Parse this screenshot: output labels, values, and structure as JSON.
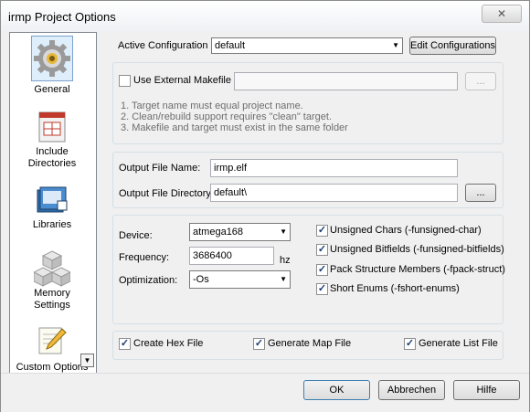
{
  "window": {
    "title": "irmp Project Options",
    "close_symbol": "✕"
  },
  "sidebar": {
    "items": [
      {
        "label": "General",
        "icon": "gear-icon"
      },
      {
        "label": "Include Directories",
        "icon": "include-directories-icon"
      },
      {
        "label": "Libraries",
        "icon": "books-icon"
      },
      {
        "label": "Memory Settings",
        "icon": "memory-cubes-icon"
      },
      {
        "label": "Custom Options",
        "icon": "pencil-icon"
      }
    ],
    "scroll_symbol": "▼"
  },
  "config": {
    "active_label": "Active Configuration",
    "active_value": "default",
    "edit_button": "Edit Configurations"
  },
  "makefile": {
    "checkbox_label": "Use External Makefile",
    "checked": false,
    "path_value": "",
    "browse_label": "...",
    "notes": [
      "1. Target name must equal project name.",
      "2. Clean/rebuild support requires  \"clean\" target.",
      "3. Makefile and target must exist in the same folder"
    ]
  },
  "output": {
    "file_name_label": "Output File Name:",
    "file_name_value": "irmp.elf",
    "directory_label": "Output File Directory:",
    "directory_value": "default\\",
    "browse_label": "..."
  },
  "device": {
    "device_label": "Device:",
    "device_value": "atmega168",
    "frequency_label": "Frequency:",
    "frequency_value": "3686400",
    "frequency_unit": "hz",
    "optimization_label": "Optimization:",
    "optimization_value": "-Os"
  },
  "compiler_flags": [
    {
      "label": "Unsigned Chars (-funsigned-char)",
      "checked": true
    },
    {
      "label": "Unsigned Bitfields (-funsigned-bitfields)",
      "checked": true
    },
    {
      "label": "Pack Structure Members (-fpack-struct)",
      "checked": true
    },
    {
      "label": "Short Enums (-fshort-enums)",
      "checked": true
    }
  ],
  "generate": [
    {
      "label": "Create Hex File",
      "checked": true
    },
    {
      "label": "Generate Map File",
      "checked": true
    },
    {
      "label": "Generate List File",
      "checked": true
    }
  ],
  "buttons": {
    "ok": "OK",
    "cancel": "Abbrechen",
    "help": "Hilfe"
  },
  "colors": {
    "selection_border": "#7da2ce",
    "selection_fill": "#dfeefb",
    "check_color": "#1b3b72"
  }
}
